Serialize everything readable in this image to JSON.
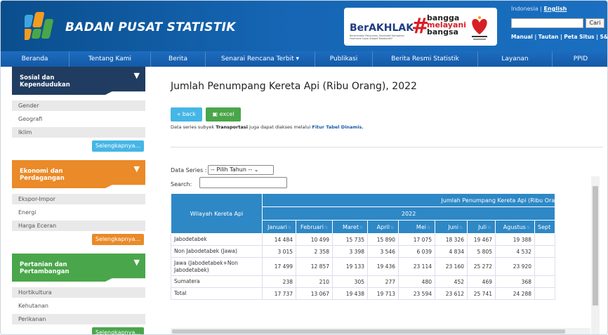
{
  "header": {
    "brand": "BADAN PUSAT STATISTIK",
    "berakhlak": "BerAKHLAK",
    "berakhlak_sub": "Berorientasi Pelayanan Akuntabel Kompeten Harmonis Loyal Adaptif Kolaboratif",
    "bangga": [
      "bangga",
      "melayani",
      "bangsa"
    ],
    "lang_id": "Indonesia",
    "lang_sep": " | ",
    "lang_en": "English",
    "search_button": "Cari",
    "top_links": "Manual | Tautan | Peta Situs | S&K"
  },
  "nav": [
    {
      "label": "Beranda"
    },
    {
      "label": "Tentang Kami"
    },
    {
      "label": "Berita"
    },
    {
      "label": "Senarai Rencana Terbit ▾"
    },
    {
      "label": "Publikasi"
    },
    {
      "label": "Berita Resmi Statistik"
    },
    {
      "label": "Layanan"
    },
    {
      "label": "PPID"
    }
  ],
  "sidebar": {
    "sections": [
      {
        "title_line1": "Sosial dan",
        "title_line2": "Kependudukan",
        "items": [
          "Gender",
          "Geografi",
          "Iklim"
        ],
        "more": "Selengkapnya..."
      },
      {
        "title_line1": "Ekonomi dan",
        "title_line2": "Perdagangan",
        "items": [
          "Ekspor-Impor",
          "Energi",
          "Harga Eceran"
        ],
        "more": "Selengkapnya..."
      },
      {
        "title_line1": "Pertanian dan",
        "title_line2": "Pertambangan",
        "items": [
          "Hortikultura",
          "Kehutanan",
          "Perikanan"
        ],
        "more": "Selengkapnya..."
      }
    ]
  },
  "main": {
    "title": "Jumlah Penumpang Kereta Api (Ribu Orang), 2022",
    "back_label": "« back",
    "excel_label": "excel",
    "note_prefix": "Data series subyek ",
    "note_subject": "Transportasi",
    "note_mid": " juga dapat diakses melalui ",
    "note_link": "Fitur Tabel Dinamis.",
    "data_series_label": "Data Series :",
    "data_series_value": "-- Pilih Tahun --",
    "search_label": "Search:"
  },
  "table": {
    "row_header": "Wilayah Kereta Api",
    "title": "Jumlah Penumpang Kereta Api (Ribu Ora",
    "year": "2022",
    "months": [
      "Januari",
      "Februari",
      "Maret",
      "April",
      "Mei",
      "Juni",
      "Juli",
      "Agustus",
      "Sept"
    ],
    "rows": [
      {
        "region": "Jabodetabek",
        "values": [
          "14 484",
          "10 499",
          "15 735",
          "15 890",
          "17 075",
          "18 326",
          "19 467",
          "19 388",
          ""
        ]
      },
      {
        "region": "Non Jabodetabek (Jawa)",
        "values": [
          "3 015",
          "2 358",
          "3 398",
          "3 546",
          "6 039",
          "4 834",
          "5 805",
          "4 532",
          ""
        ]
      },
      {
        "region": "Jawa (Jabodetabek+Non Jabodetabek)",
        "values": [
          "17 499",
          "12 857",
          "19 133",
          "19 436",
          "23 114",
          "23 160",
          "25 272",
          "23 920",
          ""
        ]
      },
      {
        "region": "Sumatera",
        "values": [
          "238",
          "210",
          "305",
          "277",
          "480",
          "452",
          "469",
          "368",
          ""
        ]
      },
      {
        "region": "Total",
        "values": [
          "17 737",
          "13 067",
          "19 438",
          "19 713",
          "23 594",
          "23 612",
          "25 741",
          "24 288",
          ""
        ]
      }
    ]
  },
  "colors": {
    "header_blue": "#1565b3",
    "nav_blue": "#1d6cc0",
    "table_header": "#2e88c6",
    "cat_blue": "#203c61",
    "cat_orange": "#ea8a28",
    "cat_green": "#4aa64a",
    "accent_red": "#d71f26"
  },
  "icons": [
    "bps-logo-icon",
    "chevron-down-icon",
    "excel-icon",
    "sort-icon"
  ]
}
